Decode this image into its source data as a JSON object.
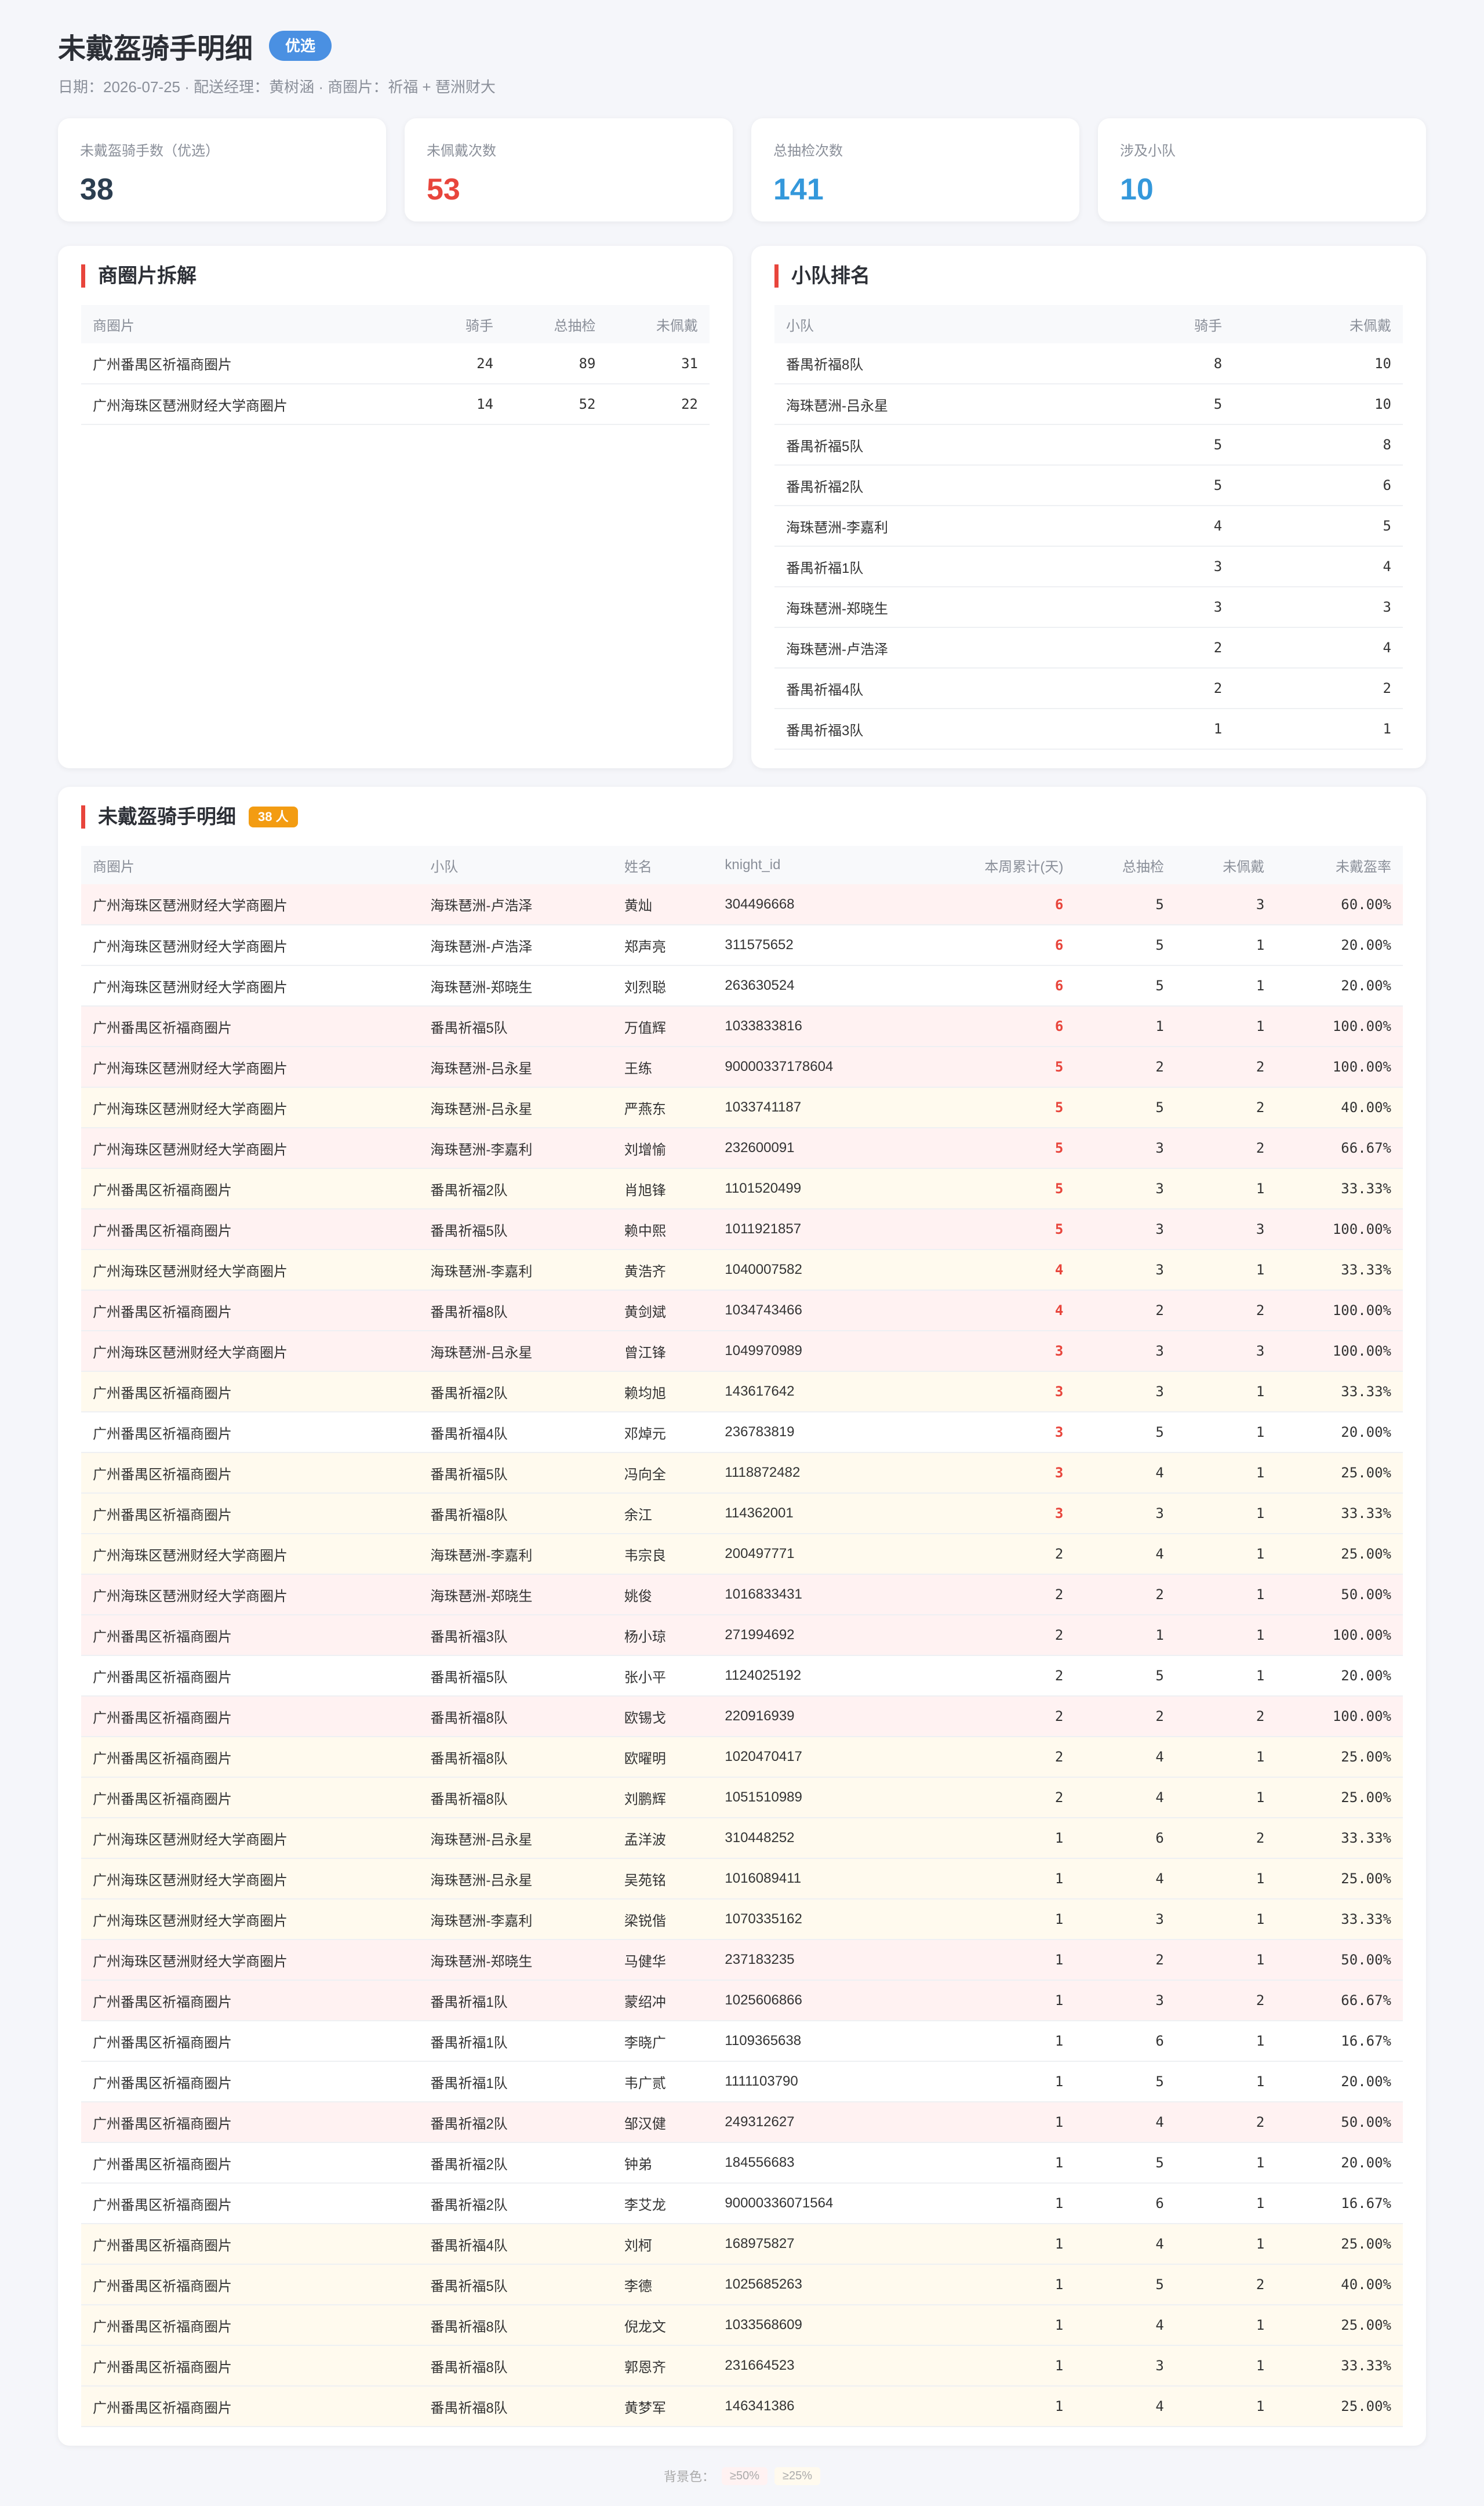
{
  "header": {
    "title": "未戴盔骑手明细",
    "pill": "优选",
    "subtitle": "日期：2026-07-25 · 配送经理：黄树涵 · 商圈片：祈福 + 琶洲财大"
  },
  "stats": [
    {
      "label": "未戴盔骑手数（优选）",
      "value": "38",
      "color": "#2c3e50"
    },
    {
      "label": "未佩戴次数",
      "value": "53",
      "color": "#e8453c"
    },
    {
      "label": "总抽检次数",
      "value": "141",
      "color": "#3498db"
    },
    {
      "label": "涉及小队",
      "value": "10",
      "color": "#3498db"
    }
  ],
  "area_card": {
    "title": "商圈片拆解",
    "headers": [
      "商圈片",
      "骑手",
      "总抽检",
      "未佩戴"
    ],
    "rows": [
      [
        "广州番禺区祈福商圈片",
        "24",
        "89",
        "31"
      ],
      [
        "广州海珠区琶洲财经大学商圈片",
        "14",
        "52",
        "22"
      ]
    ]
  },
  "team_card": {
    "title": "小队排名",
    "headers": [
      "小队",
      "骑手",
      "未佩戴"
    ],
    "rows": [
      [
        "番禺祈福8队",
        "8",
        "10"
      ],
      [
        "海珠琶洲-吕永星",
        "5",
        "10"
      ],
      [
        "番禺祈福5队",
        "5",
        "8"
      ],
      [
        "番禺祈福2队",
        "5",
        "6"
      ],
      [
        "海珠琶洲-李嘉利",
        "4",
        "5"
      ],
      [
        "番禺祈福1队",
        "3",
        "4"
      ],
      [
        "海珠琶洲-郑晓生",
        "3",
        "3"
      ],
      [
        "海珠琶洲-卢浩泽",
        "2",
        "4"
      ],
      [
        "番禺祈福4队",
        "2",
        "2"
      ],
      [
        "番禺祈福3队",
        "1",
        "1"
      ]
    ]
  },
  "detail_card": {
    "title": "未戴盔骑手明细",
    "badge": "38 人",
    "headers": [
      "商圈片",
      "小队",
      "姓名",
      "knight_id",
      "本周累计(天)",
      "总抽检",
      "未佩戴",
      "未戴盔率"
    ],
    "rows": [
      [
        "广州海珠区琶洲财经大学商圈片",
        "海珠琶洲-卢浩泽",
        "黄灿",
        "304496668",
        "6",
        "5",
        "3",
        "60.00%"
      ],
      [
        "广州海珠区琶洲财经大学商圈片",
        "海珠琶洲-卢浩泽",
        "郑声亮",
        "311575652",
        "6",
        "5",
        "1",
        "20.00%"
      ],
      [
        "广州海珠区琶洲财经大学商圈片",
        "海珠琶洲-郑晓生",
        "刘烈聪",
        "263630524",
        "6",
        "5",
        "1",
        "20.00%"
      ],
      [
        "广州番禺区祈福商圈片",
        "番禺祈福5队",
        "万值辉",
        "1033833816",
        "6",
        "1",
        "1",
        "100.00%"
      ],
      [
        "广州海珠区琶洲财经大学商圈片",
        "海珠琶洲-吕永星",
        "王练",
        "90000337178604",
        "5",
        "2",
        "2",
        "100.00%"
      ],
      [
        "广州海珠区琶洲财经大学商圈片",
        "海珠琶洲-吕永星",
        "严燕东",
        "1033741187",
        "5",
        "5",
        "2",
        "40.00%"
      ],
      [
        "广州海珠区琶洲财经大学商圈片",
        "海珠琶洲-李嘉利",
        "刘增愉",
        "232600091",
        "5",
        "3",
        "2",
        "66.67%"
      ],
      [
        "广州番禺区祈福商圈片",
        "番禺祈福2队",
        "肖旭锋",
        "1101520499",
        "5",
        "3",
        "1",
        "33.33%"
      ],
      [
        "广州番禺区祈福商圈片",
        "番禺祈福5队",
        "赖中熙",
        "1011921857",
        "5",
        "3",
        "3",
        "100.00%"
      ],
      [
        "广州海珠区琶洲财经大学商圈片",
        "海珠琶洲-李嘉利",
        "黄浩齐",
        "1040007582",
        "4",
        "3",
        "1",
        "33.33%"
      ],
      [
        "广州番禺区祈福商圈片",
        "番禺祈福8队",
        "黄剑斌",
        "1034743466",
        "4",
        "2",
        "2",
        "100.00%"
      ],
      [
        "广州海珠区琶洲财经大学商圈片",
        "海珠琶洲-吕永星",
        "曾江锋",
        "1049970989",
        "3",
        "3",
        "3",
        "100.00%"
      ],
      [
        "广州番禺区祈福商圈片",
        "番禺祈福2队",
        "赖均旭",
        "143617642",
        "3",
        "3",
        "1",
        "33.33%"
      ],
      [
        "广州番禺区祈福商圈片",
        "番禺祈福4队",
        "邓焯元",
        "236783819",
        "3",
        "5",
        "1",
        "20.00%"
      ],
      [
        "广州番禺区祈福商圈片",
        "番禺祈福5队",
        "冯向全",
        "1118872482",
        "3",
        "4",
        "1",
        "25.00%"
      ],
      [
        "广州番禺区祈福商圈片",
        "番禺祈福8队",
        "余江",
        "114362001",
        "3",
        "3",
        "1",
        "33.33%"
      ],
      [
        "广州海珠区琶洲财经大学商圈片",
        "海珠琶洲-李嘉利",
        "韦宗良",
        "200497771",
        "2",
        "4",
        "1",
        "25.00%"
      ],
      [
        "广州海珠区琶洲财经大学商圈片",
        "海珠琶洲-郑晓生",
        "姚俊",
        "1016833431",
        "2",
        "2",
        "1",
        "50.00%"
      ],
      [
        "广州番禺区祈福商圈片",
        "番禺祈福3队",
        "杨小琼",
        "271994692",
        "2",
        "1",
        "1",
        "100.00%"
      ],
      [
        "广州番禺区祈福商圈片",
        "番禺祈福5队",
        "张小平",
        "1124025192",
        "2",
        "5",
        "1",
        "20.00%"
      ],
      [
        "广州番禺区祈福商圈片",
        "番禺祈福8队",
        "欧锡戈",
        "220916939",
        "2",
        "2",
        "2",
        "100.00%"
      ],
      [
        "广州番禺区祈福商圈片",
        "番禺祈福8队",
        "欧曜明",
        "1020470417",
        "2",
        "4",
        "1",
        "25.00%"
      ],
      [
        "广州番禺区祈福商圈片",
        "番禺祈福8队",
        "刘鹏辉",
        "1051510989",
        "2",
        "4",
        "1",
        "25.00%"
      ],
      [
        "广州海珠区琶洲财经大学商圈片",
        "海珠琶洲-吕永星",
        "孟洋波",
        "310448252",
        "1",
        "6",
        "2",
        "33.33%"
      ],
      [
        "广州海珠区琶洲财经大学商圈片",
        "海珠琶洲-吕永星",
        "吴苑铭",
        "1016089411",
        "1",
        "4",
        "1",
        "25.00%"
      ],
      [
        "广州海珠区琶洲财经大学商圈片",
        "海珠琶洲-李嘉利",
        "梁锐偕",
        "1070335162",
        "1",
        "3",
        "1",
        "33.33%"
      ],
      [
        "广州海珠区琶洲财经大学商圈片",
        "海珠琶洲-郑晓生",
        "马健华",
        "237183235",
        "1",
        "2",
        "1",
        "50.00%"
      ],
      [
        "广州番禺区祈福商圈片",
        "番禺祈福1队",
        "蒙绍冲",
        "1025606866",
        "1",
        "3",
        "2",
        "66.67%"
      ],
      [
        "广州番禺区祈福商圈片",
        "番禺祈福1队",
        "李晓广",
        "1109365638",
        "1",
        "6",
        "1",
        "16.67%"
      ],
      [
        "广州番禺区祈福商圈片",
        "番禺祈福1队",
        "韦广贰",
        "1111103790",
        "1",
        "5",
        "1",
        "20.00%"
      ],
      [
        "广州番禺区祈福商圈片",
        "番禺祈福2队",
        "邹汉健",
        "249312627",
        "1",
        "4",
        "2",
        "50.00%"
      ],
      [
        "广州番禺区祈福商圈片",
        "番禺祈福2队",
        "钟弟",
        "184556683",
        "1",
        "5",
        "1",
        "20.00%"
      ],
      [
        "广州番禺区祈福商圈片",
        "番禺祈福2队",
        "李艾龙",
        "90000336071564",
        "1",
        "6",
        "1",
        "16.67%"
      ],
      [
        "广州番禺区祈福商圈片",
        "番禺祈福4队",
        "刘柯",
        "168975827",
        "1",
        "4",
        "1",
        "25.00%"
      ],
      [
        "广州番禺区祈福商圈片",
        "番禺祈福5队",
        "李德",
        "1025685263",
        "1",
        "5",
        "2",
        "40.00%"
      ],
      [
        "广州番禺区祈福商圈片",
        "番禺祈福8队",
        "倪龙文",
        "1033568609",
        "1",
        "4",
        "1",
        "25.00%"
      ],
      [
        "广州番禺区祈福商圈片",
        "番禺祈福8队",
        "郭恩齐",
        "231664523",
        "1",
        "3",
        "1",
        "33.33%"
      ],
      [
        "广州番禺区祈福商圈片",
        "番禺祈福8队",
        "黄梦军",
        "146341386",
        "1",
        "4",
        "1",
        "25.00%"
      ]
    ]
  },
  "footer": {
    "label": "背景色：",
    "legend": [
      {
        "text": "≥50%",
        "color": "#fff2f2"
      },
      {
        "text": "≥25%",
        "color": "#fffaee"
      }
    ]
  },
  "colors": {
    "accent_red": "#e8453c",
    "accent_blue": "#3498db",
    "pill_blue": "#4a90e2",
    "badge_orange": "#f39c12"
  }
}
